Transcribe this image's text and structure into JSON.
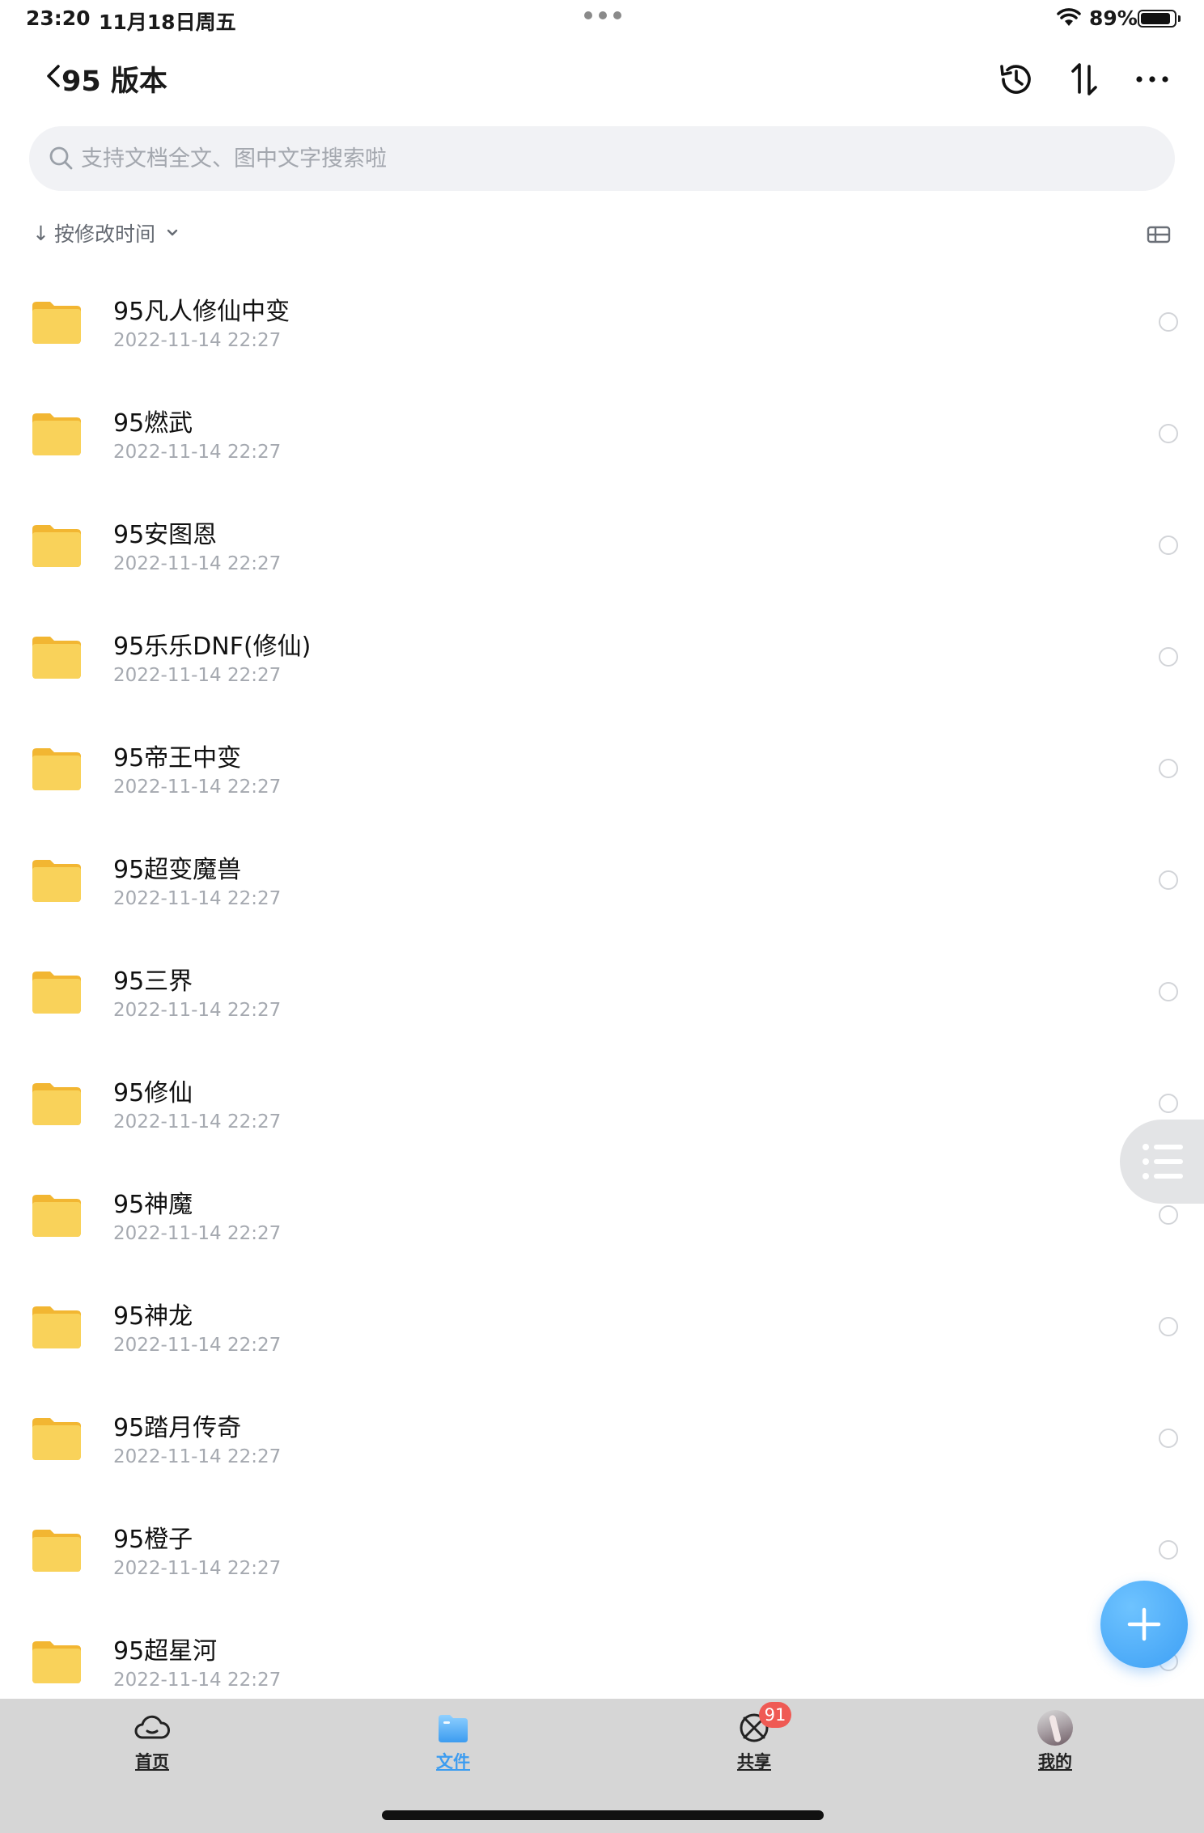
{
  "status_bar": {
    "time": "23:20",
    "date": "11月18日周五",
    "battery_pct": "89%",
    "battery_level": 0.89
  },
  "nav": {
    "title": "95 版本"
  },
  "search": {
    "placeholder": "支持文档全文、图中文字搜索啦"
  },
  "sort": {
    "arrow": "↓",
    "label": "按修改时间"
  },
  "files": [
    {
      "name": "95凡人修仙中变",
      "time": "2022-11-14 22:27"
    },
    {
      "name": "95燃武",
      "time": "2022-11-14 22:27"
    },
    {
      "name": "95安图恩",
      "time": "2022-11-14 22:27"
    },
    {
      "name": "95乐乐DNF(修仙)",
      "time": "2022-11-14 22:27"
    },
    {
      "name": "95帝王中变",
      "time": "2022-11-14 22:27"
    },
    {
      "name": "95超变魔兽",
      "time": "2022-11-14 22:27"
    },
    {
      "name": "95三界",
      "time": "2022-11-14 22:27"
    },
    {
      "name": "95修仙",
      "time": "2022-11-14 22:27"
    },
    {
      "name": "95神魔",
      "time": "2022-11-14 22:27"
    },
    {
      "name": "95神龙",
      "time": "2022-11-14 22:27"
    },
    {
      "name": "95踏月传奇",
      "time": "2022-11-14 22:27"
    },
    {
      "name": "95橙子",
      "time": "2022-11-14 22:27"
    },
    {
      "name": "95超星河",
      "time": "2022-11-14 22:27"
    }
  ],
  "tabs": [
    {
      "label": "首页",
      "icon": "cloud-icon",
      "active": false
    },
    {
      "label": "文件",
      "icon": "folder-icon",
      "active": true
    },
    {
      "label": "共享",
      "icon": "share-icon",
      "active": false,
      "badge": "91"
    },
    {
      "label": "我的",
      "icon": "avatar",
      "active": false
    }
  ],
  "colors": {
    "accent": "#3c9cf0",
    "folder": "#f7c948",
    "badge": "#ef5a54",
    "tab_bar_bg": "#d6d6d6"
  }
}
